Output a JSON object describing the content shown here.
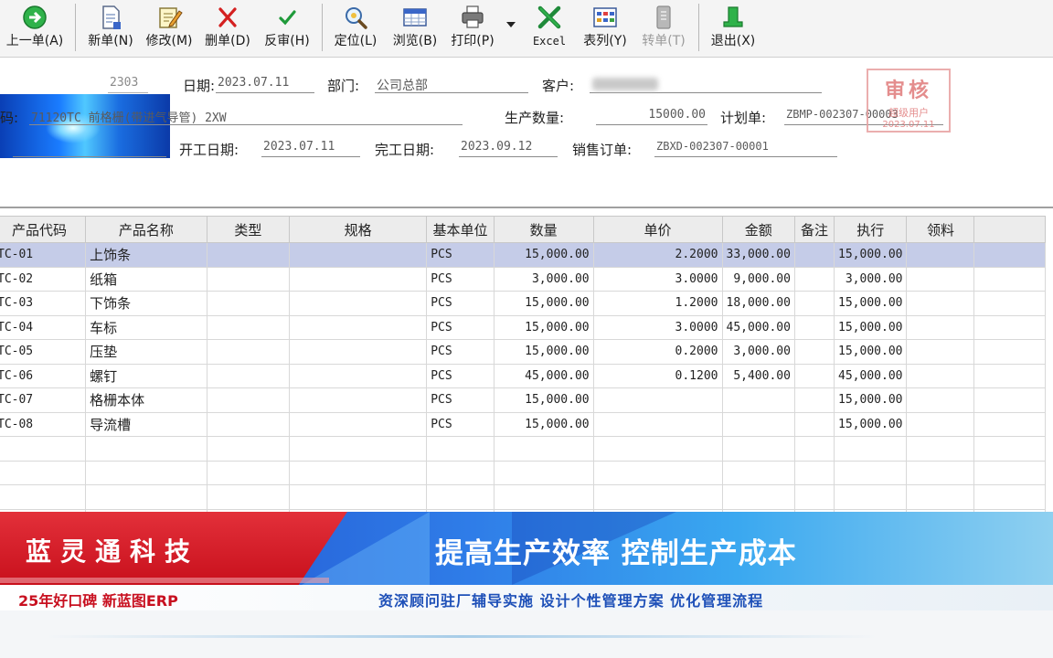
{
  "toolbar": {
    "buttons": [
      {
        "label": "上一单(A)",
        "icon": "green-circle-arrow-icon"
      },
      {
        "label": "新单(N)",
        "icon": "new-document-icon"
      },
      {
        "label": "修改(M)",
        "icon": "edit-pencil-icon"
      },
      {
        "label": "删单(D)",
        "icon": "red-x-icon"
      },
      {
        "label": "反审(H)",
        "icon": "green-check-icon"
      },
      {
        "label": "定位(L)",
        "icon": "locate-magnifier-icon"
      },
      {
        "label": "浏览(B)",
        "icon": "browse-table-icon"
      },
      {
        "label": "打印(P)",
        "icon": "printer-icon"
      },
      {
        "label": "Excel",
        "icon": "excel-icon"
      },
      {
        "label": "表列(Y)",
        "icon": "columns-grid-icon"
      },
      {
        "label": "转单(T)",
        "icon": "convert-document-icon"
      },
      {
        "label": "退出(X)",
        "icon": "exit-icon"
      }
    ]
  },
  "form": {
    "order_no": "2303",
    "date_label": "日期:",
    "date_value": "2023.07.11",
    "dept_label": "部门:",
    "dept_value": "公司总部",
    "customer_label": "客户:",
    "product_label": "码:",
    "product_value": "71120TC 前格栅(带进气导管) 2XW",
    "qty_label": "生产数量:",
    "qty_value": "15000.00",
    "plan_label": "计划单:",
    "plan_value": "ZBMP-002307-00003",
    "start_label": "开工日期:",
    "start_value": "2023.07.11",
    "finish_label": "完工日期:",
    "finish_value": "2023.09.12",
    "sales_label": "销售订单:",
    "sales_value": "ZBXD-002307-00001"
  },
  "stamp": {
    "title": "审核",
    "line1": "超级用户",
    "line2": "2023.07.11"
  },
  "grid": {
    "columns": [
      "产品代码",
      "产品名称",
      "类型",
      "规格",
      "基本单位",
      "数量",
      "单价",
      "金额",
      "备注",
      "执行",
      "领料"
    ],
    "rows": [
      [
        "TC-01",
        "上饰条",
        "",
        "",
        "PCS",
        "15,000.00",
        "2.2000",
        "33,000.00",
        "",
        "15,000.00",
        ""
      ],
      [
        "TC-02",
        "纸箱",
        "",
        "",
        "PCS",
        "3,000.00",
        "3.0000",
        "9,000.00",
        "",
        "3,000.00",
        ""
      ],
      [
        "TC-03",
        "下饰条",
        "",
        "",
        "PCS",
        "15,000.00",
        "1.2000",
        "18,000.00",
        "",
        "15,000.00",
        ""
      ],
      [
        "TC-04",
        "车标",
        "",
        "",
        "PCS",
        "15,000.00",
        "3.0000",
        "45,000.00",
        "",
        "15,000.00",
        ""
      ],
      [
        "TC-05",
        "压垫",
        "",
        "",
        "PCS",
        "15,000.00",
        "0.2000",
        "3,000.00",
        "",
        "15,000.00",
        ""
      ],
      [
        "TC-06",
        "螺钉",
        "",
        "",
        "PCS",
        "45,000.00",
        "0.1200",
        "5,400.00",
        "",
        "45,000.00",
        ""
      ],
      [
        "TC-07",
        "格栅本体",
        "",
        "",
        "PCS",
        "15,000.00",
        "",
        "",
        "",
        "15,000.00",
        ""
      ],
      [
        "TC-08",
        "导流槽",
        "",
        "",
        "PCS",
        "15,000.00",
        "",
        "",
        "",
        "15,000.00",
        ""
      ]
    ],
    "empty_rows": 4,
    "selected_row": 0
  },
  "banner": {
    "company": "蓝灵通科技",
    "slogan": "提高生产效率 控制生产成本",
    "tagline_left": "25年好口碑 新蓝图ERP",
    "tagline_right": "资深顾问驻厂辅导实施 设计个性管理方案    优化管理流程"
  },
  "colors": {
    "banner_red": "#d01a24",
    "banner_blue": "#2a6fe0",
    "selected_row": "#c5cce8",
    "stamp_red": "#e07a7a"
  }
}
